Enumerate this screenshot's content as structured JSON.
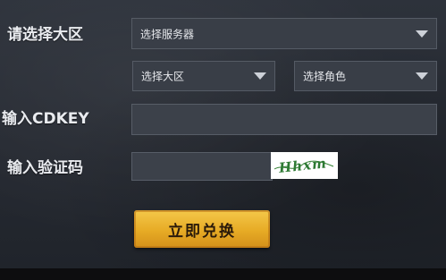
{
  "form": {
    "region_label": "请选择大区",
    "cdkey_label": "输入CDKEY",
    "captcha_label": "输入验证码",
    "server_select": {
      "value": "选择服务器"
    },
    "region_select": {
      "value": "选择大区"
    },
    "role_select": {
      "value": "选择角色"
    },
    "cdkey_input": {
      "value": ""
    },
    "captcha_input": {
      "value": ""
    },
    "captcha_image_text": "Hhxm",
    "submit_label": "立即兑换"
  },
  "colors": {
    "background": "#2a2f38",
    "field": "#3a3f48",
    "button": "#e7ab25",
    "label": "#e9ebef"
  }
}
